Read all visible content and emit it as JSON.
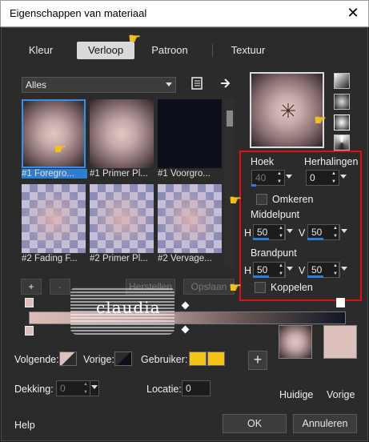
{
  "window": {
    "title": "Eigenschappen van materiaal"
  },
  "tabs": [
    "Kleur",
    "Verloop",
    "Patroon",
    "Textuur"
  ],
  "filter": {
    "selected": "Alles"
  },
  "gradients": [
    {
      "label": "#1 Foregro..."
    },
    {
      "label": "#1 Primer Pl..."
    },
    {
      "label": "#1 Voorgro..."
    },
    {
      "label": "#2 Fading F..."
    },
    {
      "label": "#2 Primer Pl..."
    },
    {
      "label": "#2 Vervage..."
    }
  ],
  "editor_buttons": {
    "add": "+",
    "remove": "-",
    "restore": "Herstellen",
    "save": "Opslaan"
  },
  "settings": {
    "angle_label": "Hoek",
    "angle_value": "40",
    "repeats_label": "Herhalingen",
    "repeats_value": "0",
    "invert_label": "Omkeren",
    "midpoint_label": "Middelpunt",
    "midpoint_h_label": "H",
    "midpoint_h": "50",
    "midpoint_v_label": "V",
    "midpoint_v": "50",
    "focal_label": "Brandpunt",
    "focal_h_label": "H",
    "focal_h": "50",
    "focal_v_label": "V",
    "focal_v": "50",
    "link_label": "Koppelen"
  },
  "watermark": {
    "text": "claudia"
  },
  "stops": {
    "next_label": "Volgende:",
    "prev_label": "Vorige:",
    "user_label": "Gebruiker:",
    "opacity_label": "Dekking:",
    "opacity_value": "0",
    "location_label": "Locatie:",
    "location_value": "0"
  },
  "swap": {
    "label": "+"
  },
  "current": {
    "label": "Huidige"
  },
  "previous": {
    "label": "Vorige"
  },
  "footer": {
    "help": "Help",
    "ok": "OK",
    "cancel": "Annuleren"
  },
  "colors": {
    "foreground": "#ddbfbc",
    "background": "#0c0f1c",
    "user1": "#f2c318",
    "user2": "#f2c318",
    "accent": "#2e7fd4",
    "highlight_box": "#e01010"
  }
}
